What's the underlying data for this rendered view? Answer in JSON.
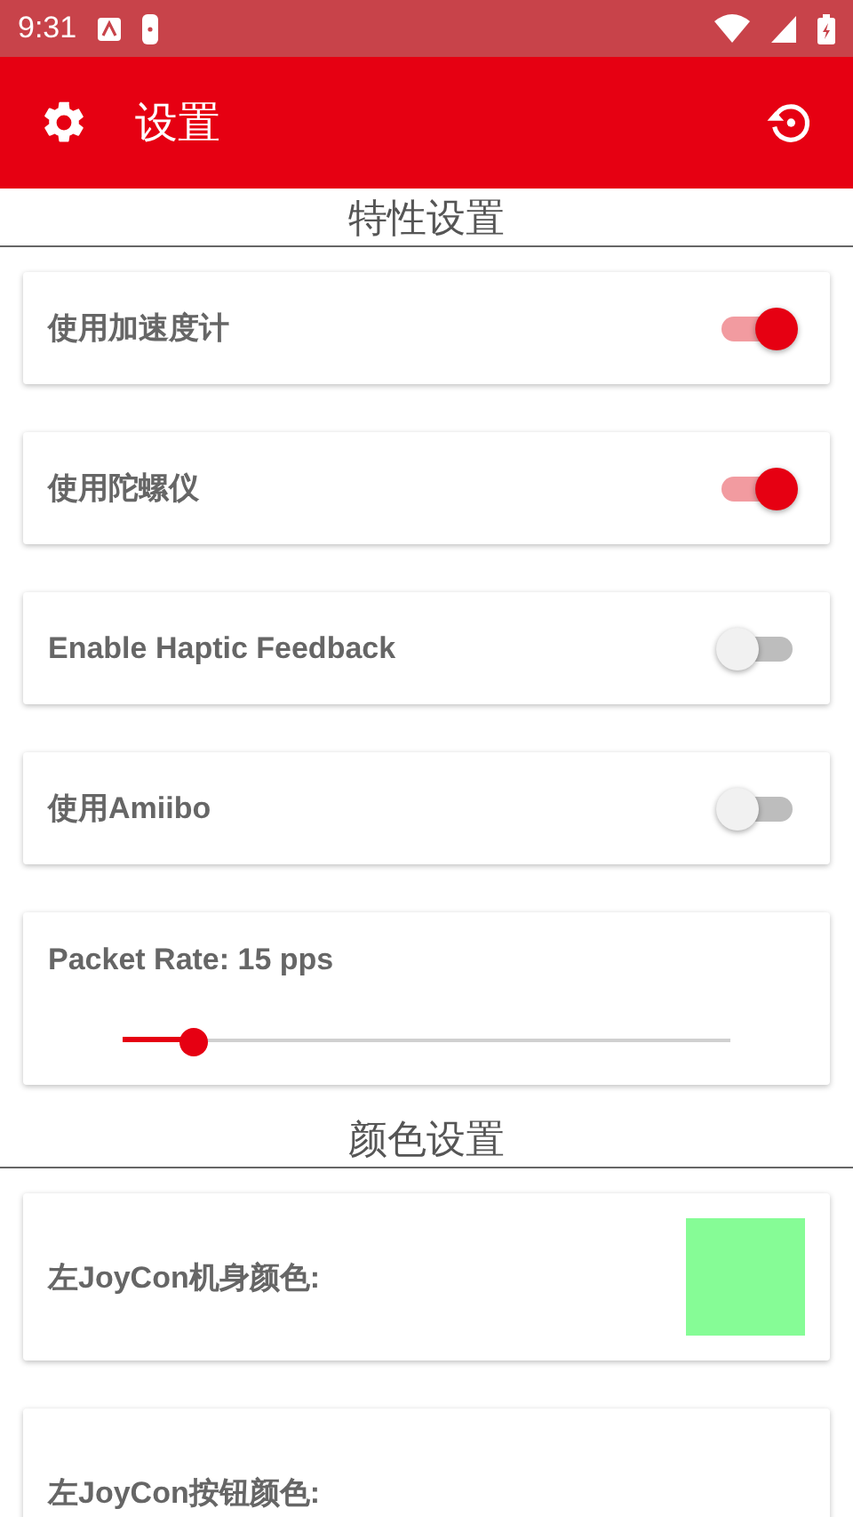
{
  "status_bar": {
    "time": "9:31"
  },
  "app_bar": {
    "title": "设置"
  },
  "sections": [
    {
      "title": "特性设置",
      "items": [
        {
          "kind": "switch",
          "label": "使用加速度计",
          "on": true
        },
        {
          "kind": "switch",
          "label": "使用陀螺仪",
          "on": true
        },
        {
          "kind": "switch",
          "label": "Enable Haptic Feedback",
          "on": false
        },
        {
          "kind": "switch",
          "label": "使用Amiibo",
          "on": false
        },
        {
          "kind": "slider",
          "label": "Packet Rate: 15 pps",
          "level": 0.117
        }
      ]
    },
    {
      "title": "颜色设置",
      "items": [
        {
          "kind": "color",
          "label": "左JoyCon机身颜色:",
          "color": "#86fc96"
        },
        {
          "kind": "color",
          "label": "左JoyCon按钮颜色:"
        }
      ]
    }
  ]
}
